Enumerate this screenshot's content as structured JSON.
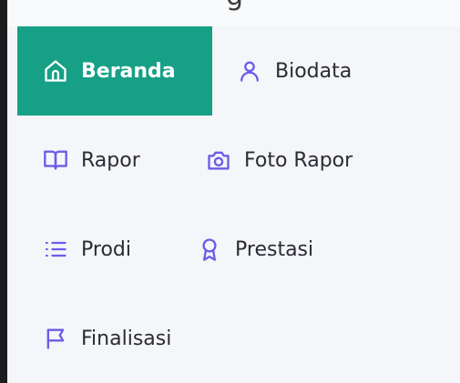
{
  "header": {
    "partial_text": "g"
  },
  "menu": {
    "items": [
      {
        "key": "beranda",
        "label": "Beranda",
        "icon": "home-icon",
        "active": true
      },
      {
        "key": "biodata",
        "label": "Biodata",
        "icon": "user-icon",
        "active": false
      },
      {
        "key": "rapor",
        "label": "Rapor",
        "icon": "book-icon",
        "active": false
      },
      {
        "key": "foto_rapor",
        "label": "Foto Rapor",
        "icon": "camera-icon",
        "active": false
      },
      {
        "key": "prodi",
        "label": "Prodi",
        "icon": "list-icon",
        "active": false
      },
      {
        "key": "prestasi",
        "label": "Prestasi",
        "icon": "award-icon",
        "active": false
      },
      {
        "key": "finalisasi",
        "label": "Finalisasi",
        "icon": "flag-icon",
        "active": false
      }
    ]
  },
  "colors": {
    "active_bg": "#16a085",
    "icon": "#6c5ce7",
    "text": "#2b2b33",
    "background": "#f5f6fa"
  }
}
